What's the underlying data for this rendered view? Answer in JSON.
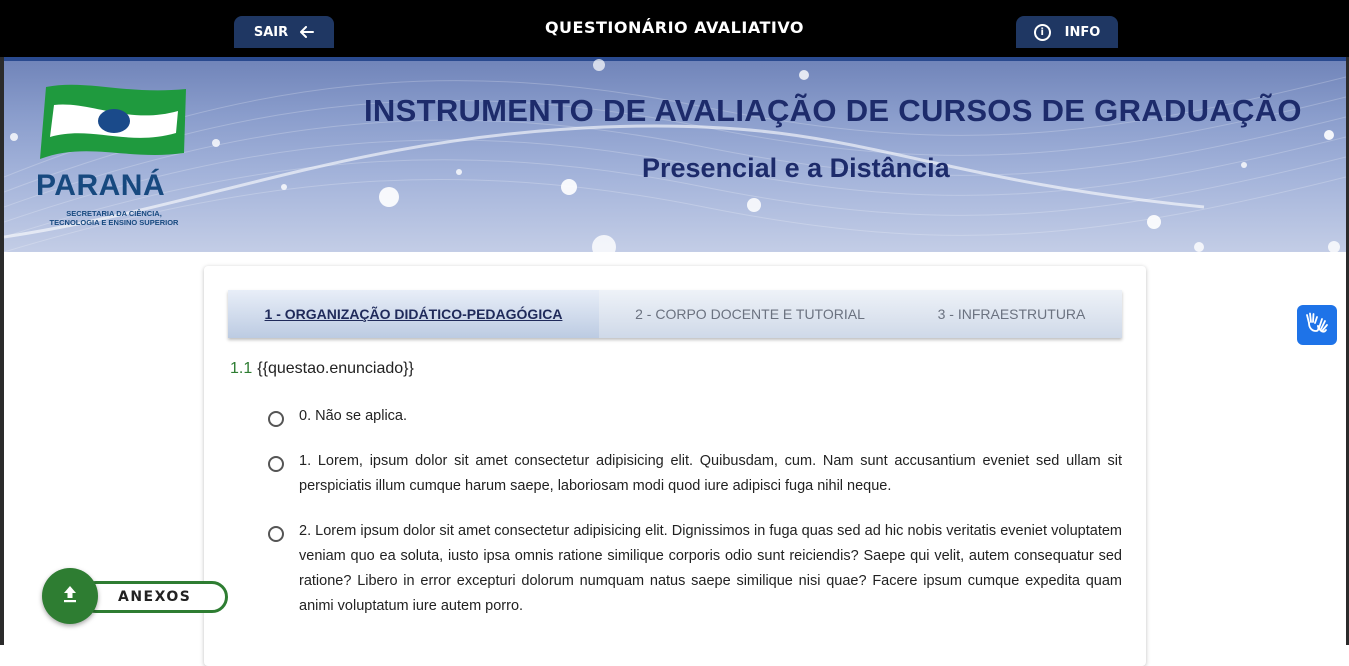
{
  "header": {
    "title": "QUESTIONÁRIO AVALIATIVO",
    "exit_label": "SAIR",
    "exit_icon": "arrow-left-icon",
    "info_label": "INFO",
    "info_icon": "info-circle-icon"
  },
  "banner": {
    "title": "INSTRUMENTO DE AVALIAÇÃO DE CURSOS DE GRADUAÇÃO",
    "subtitle": "Presencial e a Distância",
    "logo_name": "PARANÁ",
    "logo_sub_line1": "SECRETARIA DA CIÊNCIA,",
    "logo_sub_line2": "TECNOLOGIA E ENSINO SUPERIOR"
  },
  "tabs": [
    {
      "label": "1 - ORGANIZAÇÃO DIDÁTICO-PEDAGÓGICA",
      "active": true
    },
    {
      "label": "2 - CORPO DOCENTE E TUTORIAL",
      "active": false
    },
    {
      "label": "3 - INFRAESTRUTURA",
      "active": false
    }
  ],
  "question": {
    "number": "1.1",
    "text": "{{questao.enunciado}}",
    "options": [
      "0. Não se aplica.",
      "1. Lorem, ipsum dolor sit amet consectetur adipisicing elit. Quibusdam, cum. Nam sunt accusantium eveniet sed ullam sit perspiciatis illum cumque harum saepe, laboriosam modi quod iure adipisci fuga nihil neque.",
      "2. Lorem ipsum dolor sit amet consectetur adipisicing elit. Dignissimos in fuga quas sed ad hic nobis veritatis eveniet voluptatem veniam quo ea soluta, iusto ipsa omnis ratione similique corporis odio sunt reiciendis? Saepe qui velit, autem consequatur sed ratione? Libero in error excepturi dolorum numquam natus saepe similique nisi quae? Facere ipsum cumque expedita quam animi voluptatum iure autem porro."
    ]
  },
  "anexos": {
    "label": "ANEXOS",
    "icon": "upload-icon"
  },
  "accessibility": {
    "icon": "sign-language-hands-icon"
  },
  "colors": {
    "accent_green": "#2e7d32",
    "navy": "#1f3763",
    "title_blue": "#1d2b6b",
    "vlibras_blue": "#1e73e8"
  }
}
